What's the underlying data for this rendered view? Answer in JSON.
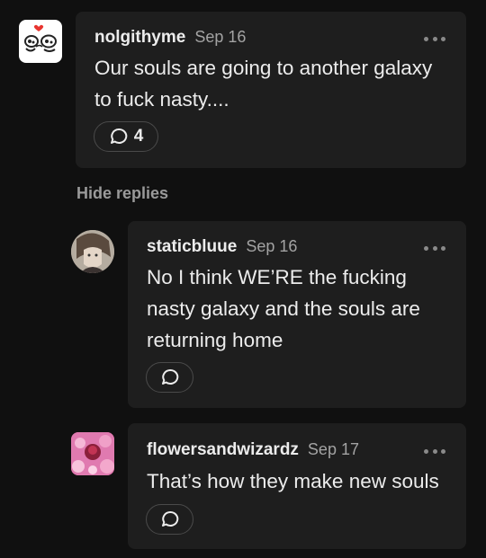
{
  "comments": [
    {
      "username": "nolgithyme",
      "date": "Sep 16",
      "text_lines": [
        "Our souls are going to another galaxy",
        "to fuck nasty...."
      ],
      "reply_count": "4",
      "avatar_icon": "cartoon-faces-avatar"
    },
    {
      "username": "staticbluue",
      "date": "Sep 16",
      "text_lines": [
        "No I think WE’RE the fucking",
        "nasty galaxy and the souls are",
        "returning home"
      ],
      "avatar_icon": "anime-character-avatar"
    },
    {
      "username": "flowersandwizardz",
      "date": "Sep 17",
      "text_lines": [
        "That’s how they make new souls"
      ],
      "avatar_icon": "pink-flowers-avatar"
    }
  ],
  "thread": {
    "hide_replies_label": "Hide replies"
  },
  "colors": {
    "background": "#101010",
    "card": "#1e1e1e",
    "muted": "#a3a3a3"
  }
}
